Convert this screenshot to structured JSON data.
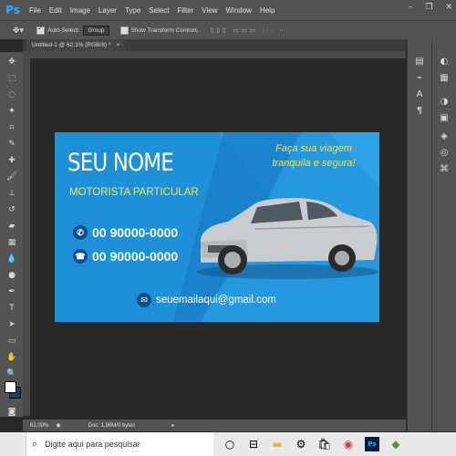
{
  "app": {
    "logo": "Ps",
    "menu": [
      "File",
      "Edit",
      "Image",
      "Layer",
      "Type",
      "Select",
      "Filter",
      "View",
      "Window",
      "Help"
    ],
    "window_buttons": [
      "–",
      "❐",
      "✕"
    ]
  },
  "options_bar": {
    "auto_select_label": "Auto-Select:",
    "auto_select_value": "Group",
    "transform_label": "Show Transform Controls"
  },
  "document": {
    "tab_title": "Untitled-1 @ 62,1% (RGB/8) *",
    "tab_close": "×"
  },
  "status": {
    "zoom": "62,09%",
    "doc_info": "Doc: 1,96M/0 bytes"
  },
  "taskbar": {
    "search_placeholder": "Digite aqui para pesquisar"
  },
  "card": {
    "name": "SEU NOME",
    "subtitle": "MOTORISTA PARTICULAR",
    "tagline_line1": "Faça sua viagem",
    "tagline_line2": "tranquila e segura!",
    "phone1": "00 90000-0000",
    "phone2": "00 90000-0000",
    "email": "seuemailaqui@gmail.com"
  },
  "colors": {
    "card_blue": "#1e90d8",
    "accent_yellow": "#f5e24a",
    "ps_blue": "#31a8ff"
  }
}
